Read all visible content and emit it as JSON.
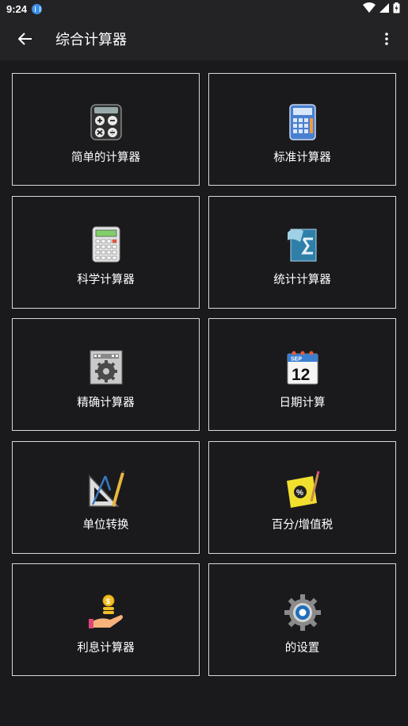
{
  "status_bar": {
    "time": "9:24"
  },
  "app_bar": {
    "title": "综合计算器"
  },
  "tiles": [
    {
      "label": "简单的计算器",
      "icon": "simple-calculator-icon"
    },
    {
      "label": "标准计算器",
      "icon": "standard-calculator-icon"
    },
    {
      "label": "科学计算器",
      "icon": "scientific-calculator-icon"
    },
    {
      "label": "统计计算器",
      "icon": "statistics-calculator-icon"
    },
    {
      "label": "精确计算器",
      "icon": "precision-calculator-icon"
    },
    {
      "label": "日期计算",
      "icon": "calendar-icon"
    },
    {
      "label": "单位转换",
      "icon": "unit-conversion-icon"
    },
    {
      "label": "百分/增值税",
      "icon": "percent-icon"
    },
    {
      "label": "利息计算器",
      "icon": "interest-coins-icon"
    },
    {
      "label": "的设置",
      "icon": "settings-gear-icon"
    }
  ],
  "calendar": {
    "month": "SEP",
    "day": "12"
  },
  "colors": {
    "background": "#1a1a1d",
    "app_bar": "#232326",
    "tile_border": "#d9d9d9",
    "text": "#ffffff"
  }
}
